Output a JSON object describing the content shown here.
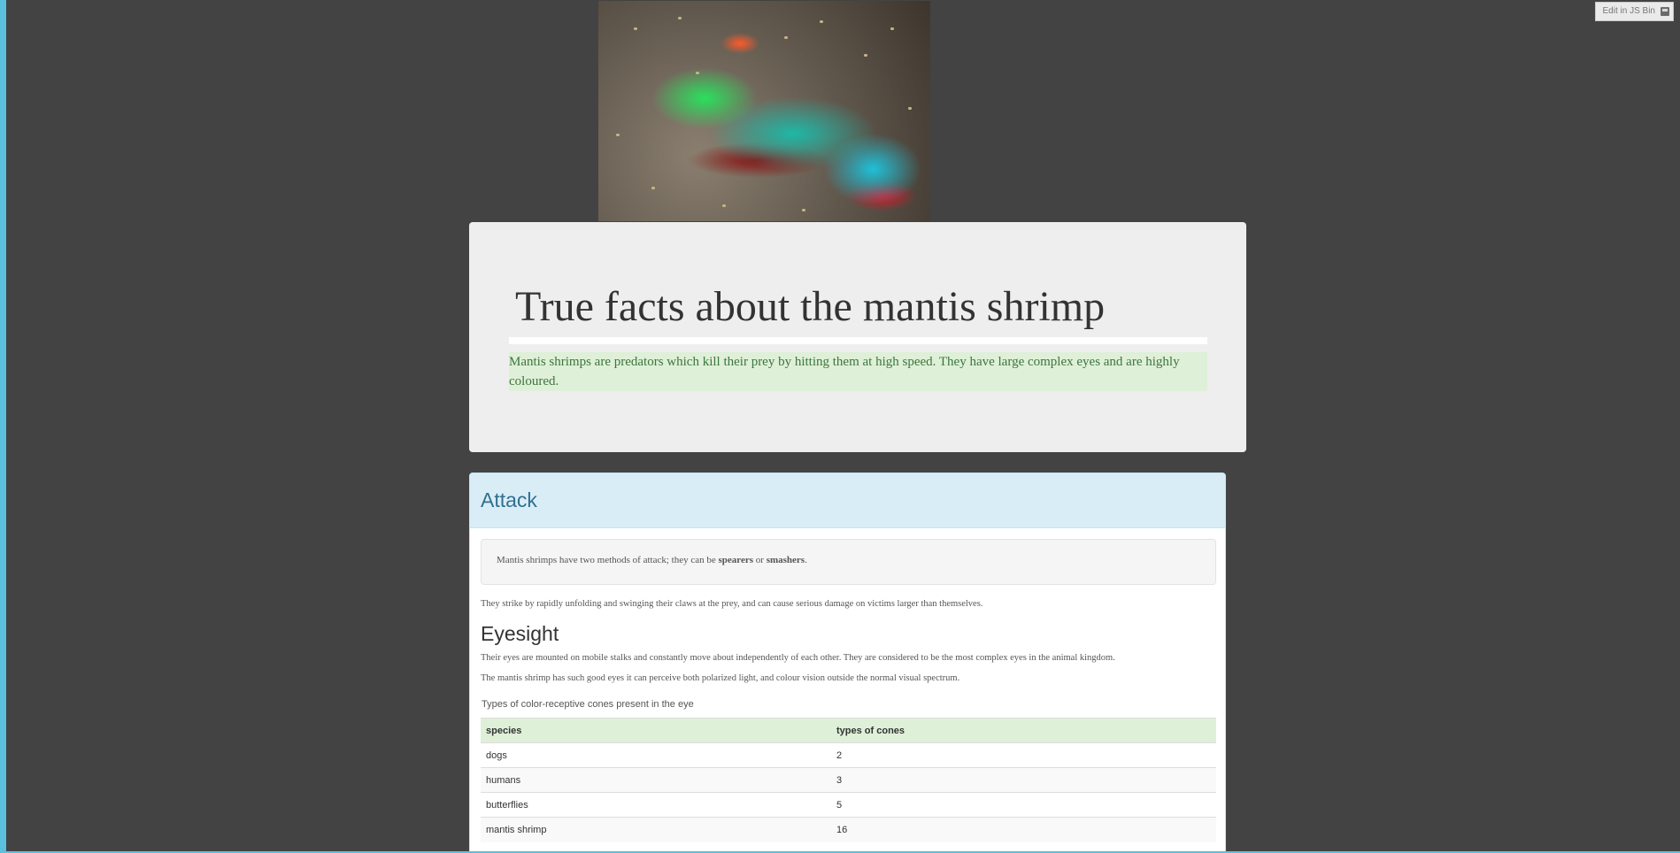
{
  "toolbar": {
    "edit_link": "Edit in JS Bin",
    "icon": "jsbin-icon"
  },
  "hero": {
    "image_subject": "mantis shrimp photo"
  },
  "jumbotron": {
    "title": "True facts about the mantis shrimp",
    "lead": "Mantis shrimps are predators which kill their prey by hitting them at high speed. They have large complex eyes and are highly coloured."
  },
  "panel": {
    "heading": "Attack",
    "well_prefix": "Mantis shrimps have two methods of attack; they can be ",
    "well_term1": "spearers",
    "well_mid": " or ",
    "well_term2": "smashers",
    "well_suffix": ".",
    "strike_text": "They strike by rapidly unfolding and swinging their claws at the prey, and can cause serious damage on victims larger than themselves.",
    "eyesight_heading": "Eyesight",
    "eyes_p1": "Their eyes are mounted on mobile stalks and constantly move about independently of each other. They are considered to be the most complex eyes in the animal kingdom.",
    "eyes_p2": "The mantis shrimp has such good eyes it can perceive both polarized light, and colour vision outside the normal visual spectrum.",
    "table_caption": "Types of color-receptive cones present in the eye",
    "table_headers": [
      "species",
      "types of cones"
    ],
    "table_rows": [
      [
        "dogs",
        "2"
      ],
      [
        "humans",
        "3"
      ],
      [
        "butterflies",
        "5"
      ],
      [
        "mantis shrimp",
        "16"
      ]
    ]
  },
  "colors": {
    "background": "#434343",
    "frame_accent": "#5bc0de",
    "jumbotron_bg": "#eeeeee",
    "lead_bg": "#dff0d8",
    "lead_text": "#3c763d",
    "panel_heading_bg": "#d9edf7",
    "panel_heading_text": "#31708f"
  }
}
